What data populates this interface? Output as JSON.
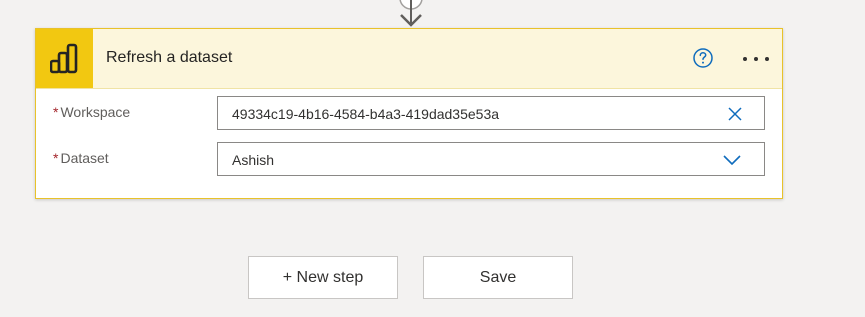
{
  "action_card": {
    "title": "Refresh a dataset",
    "fields": [
      {
        "label": "Workspace",
        "required_marker": "*",
        "value": "49334c19-4b16-4584-b4a3-419dad35e53a"
      },
      {
        "label": "Dataset",
        "required_marker": "*",
        "value": "Ashish"
      }
    ]
  },
  "footer": {
    "new_step_label": "+ New step",
    "save_label": "Save"
  },
  "colors": {
    "accent_yellow": "#f2c811",
    "header_bg": "#fcf6dc",
    "icon_blue": "#0f6cbd",
    "required_red": "#a4262c"
  },
  "icons": [
    "connector-arrow-icon",
    "power-bi-logo-icon",
    "help-icon",
    "more-options-icon",
    "clear-icon",
    "chevron-down-icon"
  ]
}
